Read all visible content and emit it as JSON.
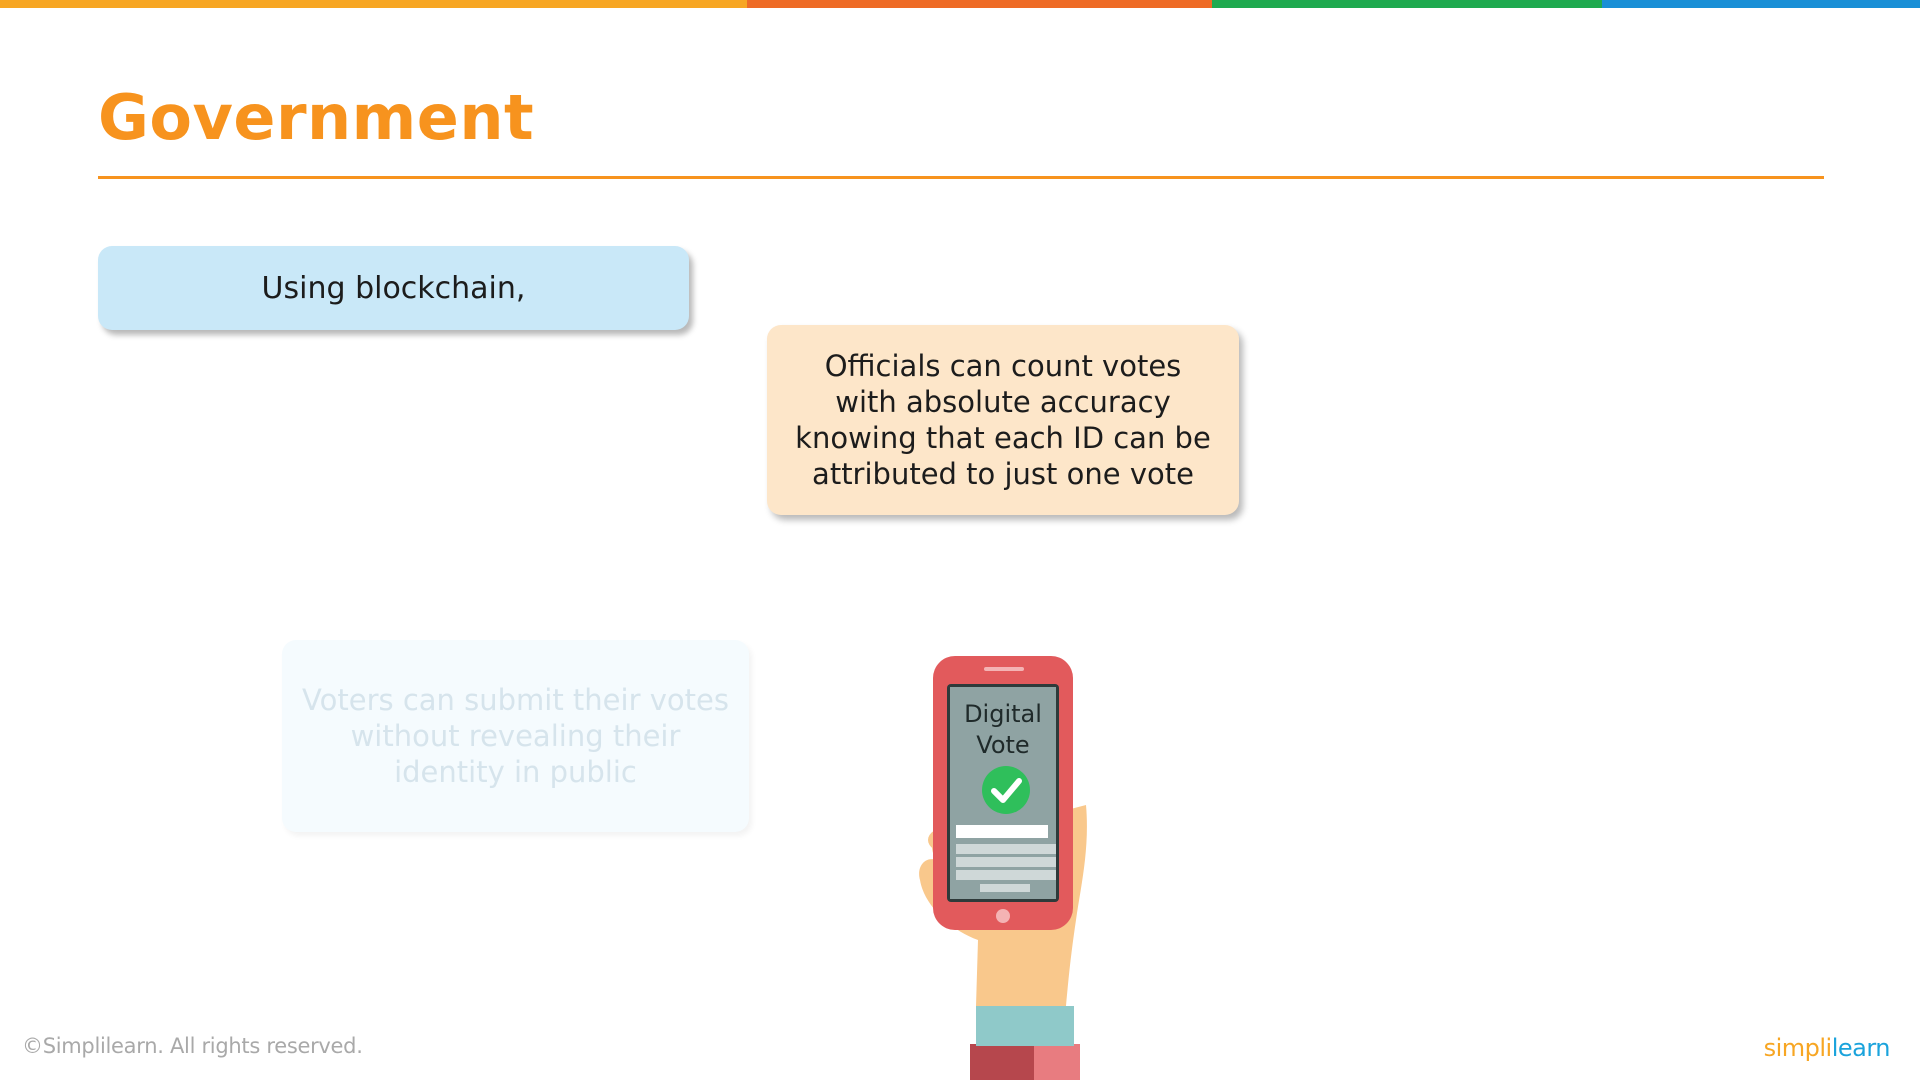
{
  "colors": {
    "accent_orange": "#f7931e",
    "intro_box": "#c9e8f8",
    "officials_box": "#fde6c9",
    "voters_box": "#f5fbfe",
    "top_bar": [
      "#f7a623",
      "#ee6b26",
      "#1faa4f",
      "#1a8fd6"
    ]
  },
  "slide": {
    "title": "Government"
  },
  "intro_box": {
    "text": "Using blockchain,"
  },
  "officials_box": {
    "lines": [
      "Officials can count votes",
      "with absolute accuracy",
      "knowing that each ID can be",
      "attributed to just one vote"
    ]
  },
  "voters_box": {
    "lines": [
      "Voters can submit their votes",
      "without revealing their",
      "identity in public"
    ]
  },
  "phone": {
    "screen_line1": "Digital",
    "screen_line2": "Vote",
    "icons": [
      "hand-icon",
      "smartphone-icon",
      "checkmark-icon",
      "keyboard-icon"
    ]
  },
  "footer": {
    "copyright": "©Simplilearn. All rights reserved.",
    "logo_part1": "simpli",
    "logo_part2": "learn"
  }
}
